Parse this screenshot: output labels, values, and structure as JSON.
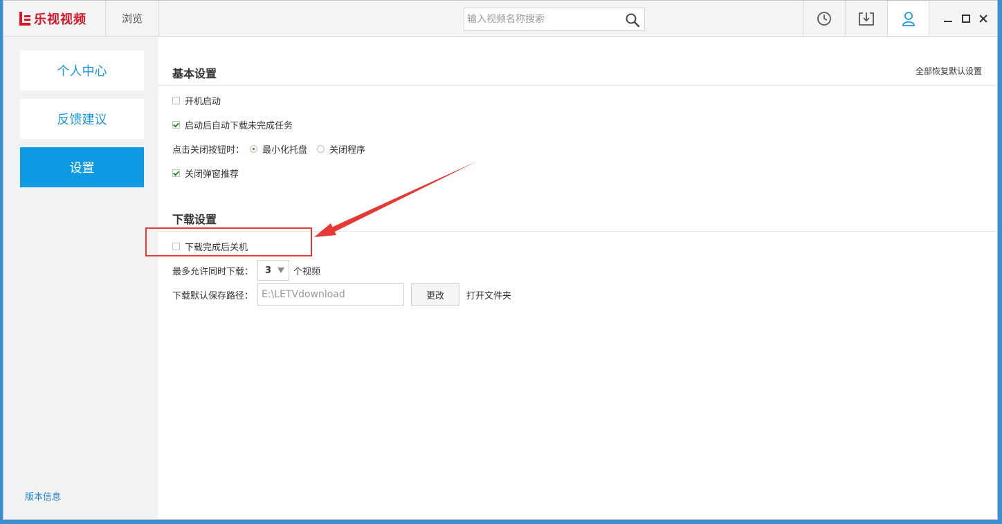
{
  "app": {
    "logo_text": "乐视视频",
    "brand_color": "#d6172a",
    "accent_color": "#0e9ae2"
  },
  "titlebar": {
    "browse_label": "浏览",
    "search_placeholder": "输入视频名称搜索",
    "icons": [
      "search-icon",
      "history-icon",
      "download-icon",
      "user-icon",
      "minimize-icon",
      "maximize-icon",
      "close-icon"
    ]
  },
  "sidebar": {
    "items": [
      {
        "label": "个人中心",
        "active": false
      },
      {
        "label": "反馈建议",
        "active": false
      },
      {
        "label": "设置",
        "active": true
      }
    ],
    "version_link": "版本信息"
  },
  "settings": {
    "basic": {
      "title": "基本设置",
      "reset_all": "全部恢复默认设置",
      "autostart": {
        "label": "开机启动",
        "checked": false
      },
      "auto_resume": {
        "label": "启动后自动下载未完成任务",
        "checked": true
      },
      "close_action": {
        "label": "点击关闭按钮时：",
        "options": [
          {
            "label": "最小化托盘",
            "selected": true
          },
          {
            "label": "关闭程序",
            "selected": false
          }
        ]
      },
      "close_popup": {
        "label": "关闭弹窗推荐",
        "checked": true
      }
    },
    "download": {
      "title": "下载设置",
      "shutdown_after": {
        "label": "下载完成后关机",
        "checked": false
      },
      "concurrent": {
        "label": "最多允许同时下载：",
        "value": "3",
        "unit": "个视频"
      },
      "path": {
        "label": "下载默认保存路径：",
        "value": "E:\\LETVdownload"
      },
      "change_button": "更改",
      "open_folder": "打开文件夹"
    }
  },
  "annotation": {
    "color": "#e53935"
  }
}
